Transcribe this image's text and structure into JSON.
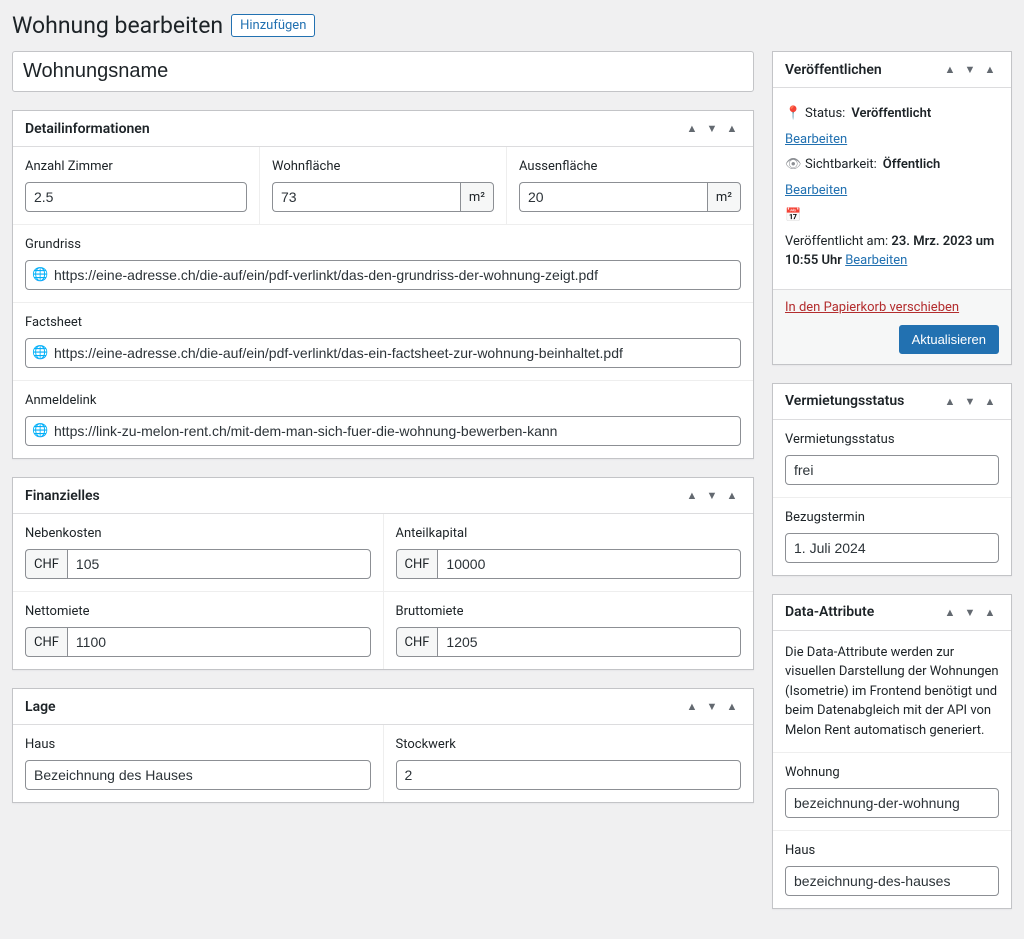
{
  "header": {
    "title": "Wohnung bearbeiten",
    "add_new": "Hinzufügen"
  },
  "post_title": "Wohnungsname",
  "detail": {
    "box_title": "Detailinformationen",
    "rooms_label": "Anzahl Zimmer",
    "rooms_value": "2.5",
    "living_area_label": "Wohnfläche",
    "living_area_value": "73",
    "living_area_unit": "m²",
    "outdoor_area_label": "Aussenfläche",
    "outdoor_area_value": "20",
    "outdoor_area_unit": "m²",
    "floorplan_label": "Grundriss",
    "floorplan_value": "https://eine-adresse.ch/die-auf/ein/pdf-verlinkt/das-den-grundriss-der-wohnung-zeigt.pdf",
    "factsheet_label": "Factsheet",
    "factsheet_value": "https://eine-adresse.ch/die-auf/ein/pdf-verlinkt/das-ein-factsheet-zur-wohnung-beinhaltet.pdf",
    "apply_label": "Anmeldelink",
    "apply_value": "https://link-zu-melon-rent.ch/mit-dem-man-sich-fuer-die-wohnung-bewerben-kann"
  },
  "finance": {
    "box_title": "Finanzielles",
    "currency": "CHF",
    "extra_costs_label": "Nebenkosten",
    "extra_costs_value": "105",
    "share_capital_label": "Anteilkapital",
    "share_capital_value": "10000",
    "net_rent_label": "Nettomiete",
    "net_rent_value": "1100",
    "gross_rent_label": "Bruttomiete",
    "gross_rent_value": "1205"
  },
  "location": {
    "box_title": "Lage",
    "house_label": "Haus",
    "house_value": "Bezeichnung des Hauses",
    "floor_label": "Stockwerk",
    "floor_value": "2"
  },
  "publish": {
    "box_title": "Veröffentlichen",
    "status_label": "Status:",
    "status_value": "Veröffentlicht",
    "edit_label": "Bearbeiten",
    "visibility_label": "Sichtbarkeit:",
    "visibility_value": "Öffentlich",
    "published_on_label": "Veröffentlicht am:",
    "published_on_value": "23. Mrz. 2023 um 10:55 Uhr",
    "trash_label": "In den Papierkorb verschieben",
    "update_label": "Aktualisieren"
  },
  "rental": {
    "box_title": "Vermietungsstatus",
    "status_label": "Vermietungsstatus",
    "status_value": "frei",
    "movein_label": "Bezugstermin",
    "movein_value": "1. Juli 2024"
  },
  "data_attr": {
    "box_title": "Data-Attribute",
    "description": "Die Data-Attribute werden zur visuellen Darstellung der Wohnungen (Isometrie) im Frontend benötigt und beim Datenabgleich mit der API von Melon Rent automatisch generiert.",
    "apartment_label": "Wohnung",
    "apartment_value": "bezeichnung-der-wohnung",
    "house_label": "Haus",
    "house_value": "bezeichnung-des-hauses"
  }
}
